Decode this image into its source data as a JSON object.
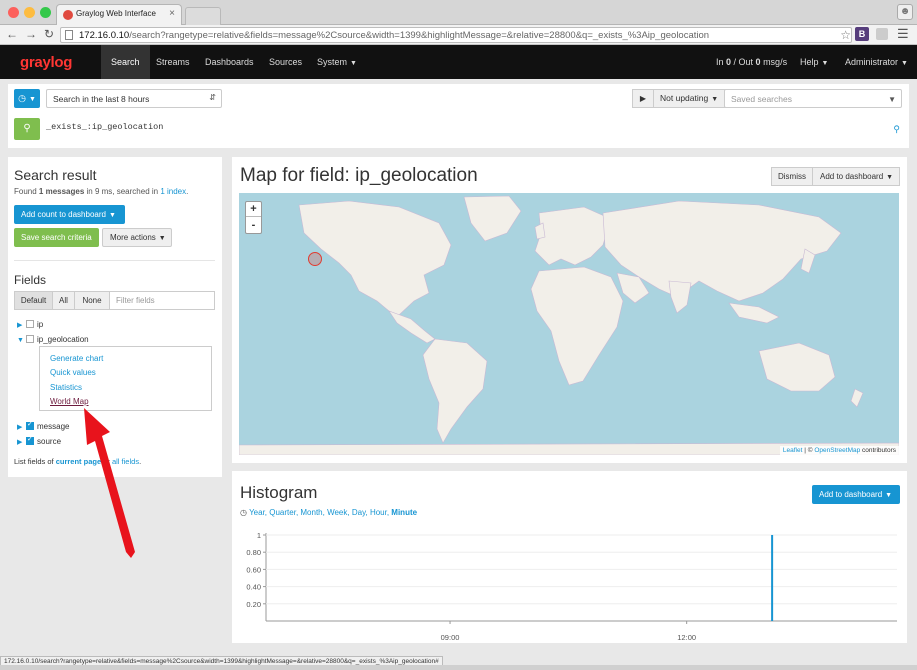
{
  "browser": {
    "tab_title": "Graylog Web Interface",
    "url_host": "172.16.0.10",
    "url_path": "/search?rangetype=relative&fields=message%2Csource&width=1399&highlightMessage=&relative=28800&q=_exists_%3Aip_geolocation",
    "status_url": "172.16.0.10/search?rangetype=relative&fields=message%2Csource&width=1399&highlightMessage=&relative=28800&q=_exists_%3Aip_geolocation#",
    "extension_label": "B"
  },
  "nav": {
    "logo": "graylog",
    "items": [
      "Search",
      "Streams",
      "Dashboards",
      "Sources",
      "System"
    ],
    "throughput_prefix": "In ",
    "throughput_in": "0",
    "throughput_mid": " / Out ",
    "throughput_out": "0",
    "throughput_suffix": " msg/s",
    "help": "Help",
    "user": "Administrator"
  },
  "search_bar": {
    "range": "Search in the last 8 hours",
    "not_updating": "Not updating",
    "saved_placeholder": "Saved searches",
    "query": "_exists_:ip_geolocation"
  },
  "result": {
    "title": "Search result",
    "found_prefix": "Found ",
    "found_count": "1 messages",
    "found_mid": " in 9 ms, searched in ",
    "found_index": "1 index",
    "found_suffix": ".",
    "add_count_btn": "Add count to dashboard",
    "save_btn": "Save search criteria",
    "more_btn": "More actions"
  },
  "fields": {
    "title": "Fields",
    "seg": [
      "Default",
      "All",
      "None"
    ],
    "filter_placeholder": "Filter fields",
    "list": [
      {
        "name": "ip",
        "checked": false,
        "expanded": false
      },
      {
        "name": "ip_geolocation",
        "checked": false,
        "expanded": true
      },
      {
        "name": "message",
        "checked": true,
        "expanded": false
      },
      {
        "name": "source",
        "checked": true,
        "expanded": false
      }
    ],
    "menu": [
      "Generate chart",
      "Quick values",
      "Statistics",
      "World Map"
    ],
    "list_prefix": "List fields of ",
    "list_current": "current page",
    "list_or": " or ",
    "list_all": "all fields",
    "list_suffix": "."
  },
  "map": {
    "title": "Map for field: ip_geolocation",
    "dismiss": "Dismiss",
    "add_to_dashboard": "Add to dashboard",
    "zoom_in": "+",
    "zoom_out": "-",
    "attr_leaflet": "Leaflet",
    "attr_sep": " | © ",
    "attr_osm": "OpenStreetMap",
    "attr_suffix": " contributors",
    "marker_lat": 37.5,
    "marker_lon": -122.0
  },
  "histogram": {
    "title": "Histogram",
    "add_to_dashboard": "Add to dashboard",
    "resolutions": [
      "Year",
      "Quarter",
      "Month",
      "Week",
      "Day",
      "Hour",
      "Minute"
    ],
    "active_resolution": "Minute"
  },
  "chart_data": {
    "type": "bar",
    "title": "Histogram",
    "x_ticks": [
      "09:00",
      "12:00"
    ],
    "y_ticks": [
      "1",
      "0.80",
      "0.60",
      "0.40",
      "0.20"
    ],
    "ylim": [
      0,
      1
    ],
    "x_range": [
      "06:40",
      "14:40"
    ],
    "series": [
      {
        "x": [
          "13:05"
        ],
        "values": [
          1
        ]
      }
    ],
    "colors": {
      "bar": "#1795d2"
    }
  },
  "colors": {
    "primary": "#1795d2",
    "success": "#7fbe4e",
    "nav_bg": "#111111",
    "logo": "#ff3633",
    "marker": "#e03c31",
    "land": "#f2efe9",
    "water": "#aad3df",
    "arrow": "#e8131c"
  }
}
